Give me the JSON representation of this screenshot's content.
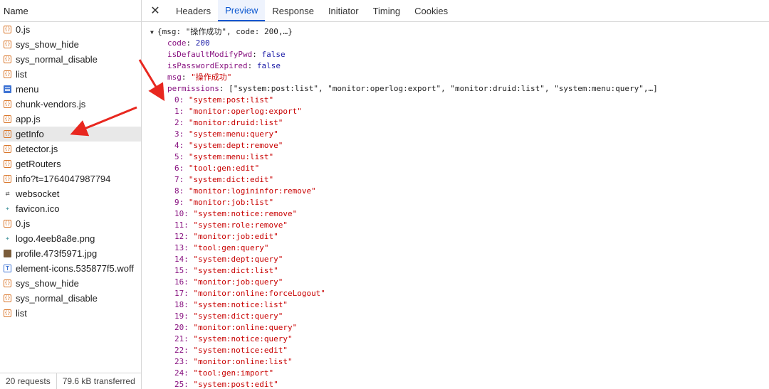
{
  "left_panel": {
    "header": "Name",
    "requests": [
      {
        "name": "0.js",
        "icon": "xhr-icon"
      },
      {
        "name": "sys_show_hide",
        "icon": "xhr-icon"
      },
      {
        "name": "sys_normal_disable",
        "icon": "xhr-icon"
      },
      {
        "name": "list",
        "icon": "xhr-icon"
      },
      {
        "name": "menu",
        "icon": "document-icon"
      },
      {
        "name": "chunk-vendors.js",
        "icon": "xhr-icon"
      },
      {
        "name": "app.js",
        "icon": "xhr-icon"
      },
      {
        "name": "getInfo",
        "icon": "xhr-icon",
        "selected": true
      },
      {
        "name": "detector.js",
        "icon": "xhr-icon"
      },
      {
        "name": "getRouters",
        "icon": "xhr-icon"
      },
      {
        "name": "info?t=1764047987794",
        "icon": "xhr-icon"
      },
      {
        "name": "websocket",
        "icon": "websocket-icon"
      },
      {
        "name": "favicon.ico",
        "icon": "image-icon"
      },
      {
        "name": "0.js",
        "icon": "xhr-icon"
      },
      {
        "name": "logo.4eeb8a8e.png",
        "icon": "image-icon"
      },
      {
        "name": "profile.473f5971.jpg",
        "icon": "photo-icon"
      },
      {
        "name": "element-icons.535877f5.woff",
        "icon": "font-icon"
      },
      {
        "name": "sys_show_hide",
        "icon": "xhr-icon"
      },
      {
        "name": "sys_normal_disable",
        "icon": "xhr-icon"
      },
      {
        "name": "list",
        "icon": "xhr-icon"
      }
    ],
    "footer": {
      "requests": "20 requests",
      "transferred": "79.6 kB transferred"
    }
  },
  "tabs": [
    "Headers",
    "Preview",
    "Response",
    "Initiator",
    "Timing",
    "Cookies"
  ],
  "active_tab": "Preview",
  "preview": {
    "summary": "{msg: \"操作成功\", code: 200,…}",
    "fields": [
      {
        "key": "code",
        "value": "200",
        "type": "num"
      },
      {
        "key": "isDefaultModifyPwd",
        "value": "false",
        "type": "num"
      },
      {
        "key": "isPasswordExpired",
        "value": "false",
        "type": "num"
      },
      {
        "key": "msg",
        "value": "\"操作成功\"",
        "type": "str"
      }
    ],
    "permissions_key": "permissions",
    "permissions_summary": "[\"system:post:list\", \"monitor:operlog:export\", \"monitor:druid:list\", \"system:menu:query\",…]",
    "permissions": [
      "system:post:list",
      "monitor:operlog:export",
      "monitor:druid:list",
      "system:menu:query",
      "system:dept:remove",
      "system:menu:list",
      "tool:gen:edit",
      "system:dict:edit",
      "monitor:logininfor:remove",
      "monitor:job:list",
      "system:notice:remove",
      "system:role:remove",
      "monitor:job:edit",
      "tool:gen:query",
      "system:dept:query",
      "system:dict:list",
      "monitor:job:query",
      "monitor:online:forceLogout",
      "system:notice:list",
      "system:dict:query",
      "monitor:online:query",
      "system:notice:query",
      "system:notice:edit",
      "monitor:online:list",
      "tool:gen:import",
      "system:post:edit"
    ]
  },
  "colors": {
    "accent": "#0b57d0",
    "annotation_arrow": "#e8271f",
    "key": "#881280",
    "string": "#c80000",
    "number": "#1a1aa6"
  }
}
